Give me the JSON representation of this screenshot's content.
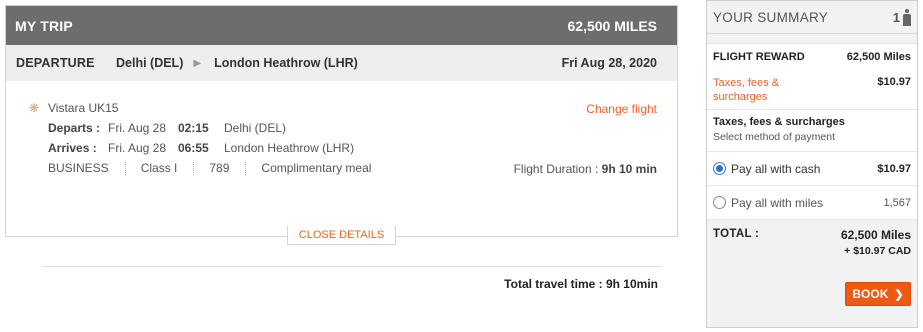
{
  "trip": {
    "title": "MY TRIP",
    "miles": "62,500 MILES",
    "departure": {
      "label": "DEPARTURE",
      "from": "Delhi (DEL)",
      "to": "London Heathrow (LHR)",
      "date": "Fri Aug 28, 2020"
    },
    "flight": {
      "name": "Vistara UK15",
      "change_link": "Change flight",
      "departs": {
        "label": "Departs :",
        "date": "Fri. Aug 28",
        "time": "02:15",
        "place": "Delhi (DEL)"
      },
      "arrives": {
        "label": "Arrives :",
        "date": "Fri. Aug 28",
        "time": "06:55",
        "place": "London Heathrow (LHR)"
      },
      "cabin": "BUSINESS",
      "class": "Class I",
      "aircraft": "789",
      "meal": "Complimentary meal",
      "duration_label": "Flight Duration :",
      "duration": "9h 10 min",
      "total_time": "Total travel time : 9h 10min"
    },
    "close_details": "CLOSE DETAILS"
  },
  "summary": {
    "title": "YOUR SUMMARY",
    "passengers": "1",
    "reward_label": "FLIGHT REWARD",
    "reward_value": "62,500 Miles",
    "taxes_label": "Taxes, fees & surcharges",
    "taxes_value": "$10.97",
    "method_title": "Taxes, fees & surcharges",
    "method_sub": "Select method of payment",
    "option_cash": {
      "label": "Pay all with cash",
      "value": "$10.97",
      "selected": true
    },
    "option_miles": {
      "label": "Pay all with miles",
      "value": "1,567",
      "selected": false
    },
    "total_label": "TOTAL :",
    "total_miles": "62,500  Miles",
    "total_cad": "+ $10.97 CAD",
    "book_label": "BOOK"
  },
  "colors": {
    "accent": "#e8622a",
    "header": "#6d6d6d",
    "button": "#ee5a12",
    "radio": "#2f6fd1"
  },
  "icons": [
    "gear-icon",
    "chevron-right-icon",
    "person-icon",
    "radio-icon"
  ]
}
